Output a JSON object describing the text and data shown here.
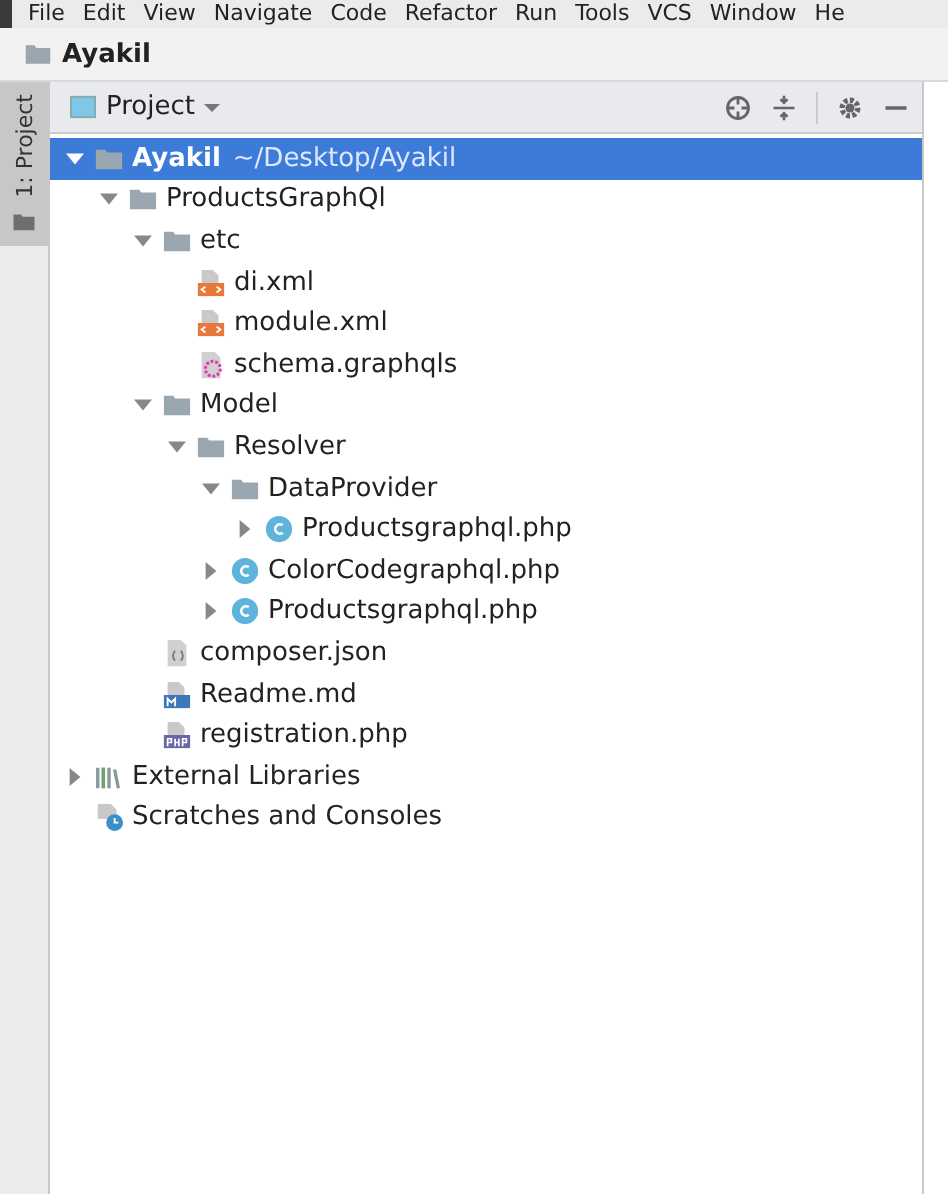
{
  "menu_bar": [
    "File",
    "Edit",
    "View",
    "Navigate",
    "Code",
    "Refactor",
    "Run",
    "Tools",
    "VCS",
    "Window",
    "He"
  ],
  "breadcrumb": {
    "label": "Ayakil"
  },
  "side_tab": {
    "label": "1: Project",
    "selected": true
  },
  "panel": {
    "title": "Project"
  },
  "tree": [
    {
      "label": "Ayakil",
      "path": "~/Desktop/Ayakil",
      "kind": "folder",
      "expanded": true,
      "selected": true,
      "children": [
        {
          "label": "ProductsGraphQl",
          "kind": "folder",
          "expanded": true,
          "selected": false,
          "children": [
            {
              "label": "etc",
              "kind": "folder",
              "expanded": true,
              "selected": false,
              "children": [
                {
                  "label": "di.xml",
                  "kind": "xml",
                  "selected": false
                },
                {
                  "label": "module.xml",
                  "kind": "xml",
                  "selected": false
                },
                {
                  "label": "schema.graphqls",
                  "kind": "graphql",
                  "selected": false
                }
              ]
            },
            {
              "label": "Model",
              "kind": "folder",
              "expanded": true,
              "selected": false,
              "children": [
                {
                  "label": "Resolver",
                  "kind": "folder",
                  "expanded": true,
                  "selected": false,
                  "children": [
                    {
                      "label": "DataProvider",
                      "kind": "folder",
                      "expanded": true,
                      "selected": false,
                      "children": [
                        {
                          "label": "Productsgraphql.php",
                          "kind": "class",
                          "expanded": false,
                          "selected": false
                        }
                      ]
                    },
                    {
                      "label": "ColorCodegraphql.php",
                      "kind": "class",
                      "expanded": false,
                      "selected": false
                    },
                    {
                      "label": "Productsgraphql.php",
                      "kind": "class",
                      "expanded": false,
                      "selected": false
                    }
                  ]
                }
              ]
            },
            {
              "label": "composer.json",
              "kind": "json",
              "selected": false
            },
            {
              "label": "Readme.md",
              "kind": "md",
              "selected": false
            },
            {
              "label": "registration.php",
              "kind": "php",
              "selected": false
            }
          ]
        }
      ]
    },
    {
      "label": "External Libraries",
      "kind": "libraries",
      "expanded": false,
      "selected": false
    },
    {
      "label": "Scratches and Consoles",
      "kind": "scratches",
      "selected": false
    }
  ]
}
